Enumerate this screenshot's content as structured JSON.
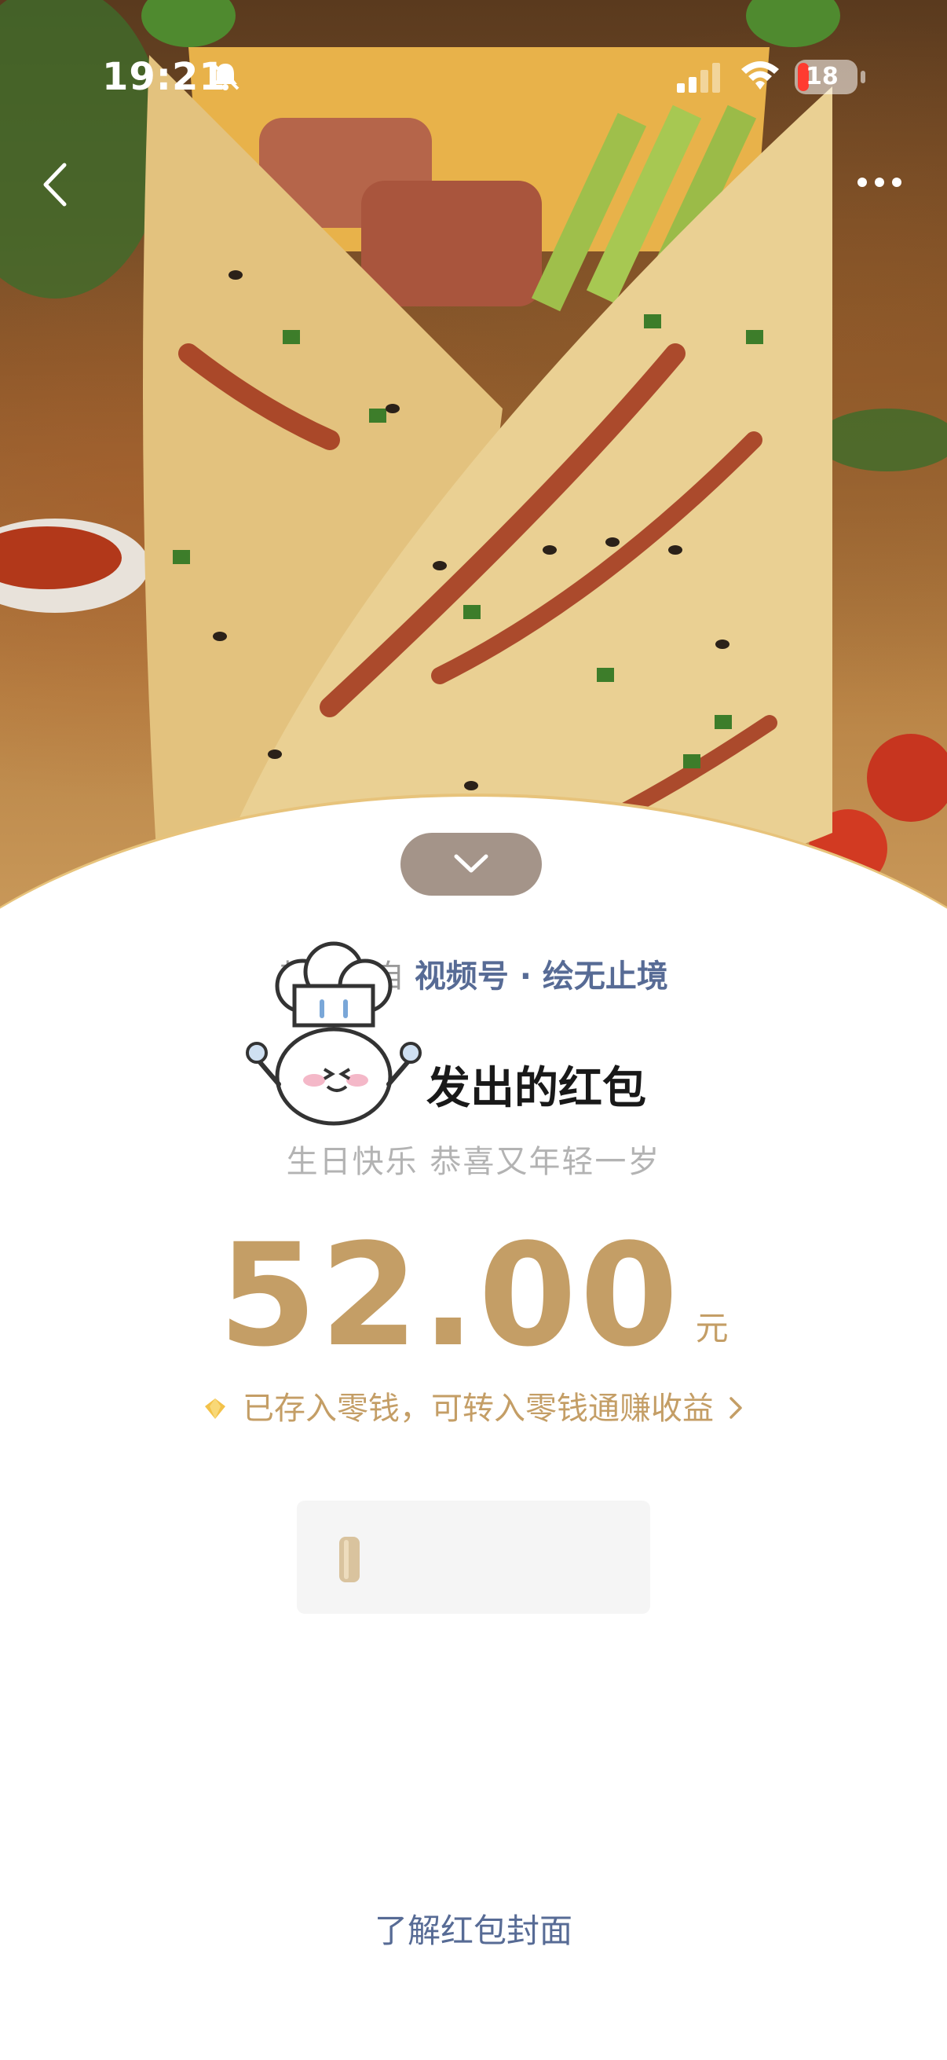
{
  "status_bar": {
    "time": "19:21",
    "battery": "18"
  },
  "sender": {
    "prefix": "封面来自",
    "source": "视频号 · 绘无止境"
  },
  "envelope": {
    "title": "发出的红包",
    "blessing": "生日快乐 恭喜又年轻一岁"
  },
  "amount": {
    "value": "52.00",
    "unit": "元"
  },
  "saved": {
    "text": "已存入零钱，可转入零钱通赚收益"
  },
  "footer": {
    "cover_link": "了解红包封面"
  },
  "icons": {
    "back": "chevron-left-icon",
    "more": "more-icon",
    "collapse": "chevron-down-icon",
    "saved": "diamond-icon",
    "saved_arrow": "chevron-right-icon"
  },
  "colors": {
    "amount": "#c49e66",
    "link": "#576b95",
    "battery_low": "#ff3b30"
  }
}
